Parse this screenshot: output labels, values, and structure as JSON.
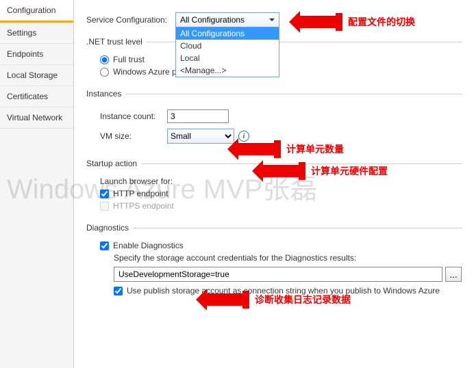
{
  "sidebar": {
    "items": [
      {
        "label": "Configuration"
      },
      {
        "label": "Settings"
      },
      {
        "label": "Endpoints"
      },
      {
        "label": "Local Storage"
      },
      {
        "label": "Certificates"
      },
      {
        "label": "Virtual Network"
      }
    ]
  },
  "serviceConfig": {
    "label": "Service Configuration:",
    "selected": "All Configurations",
    "options": [
      "All Configurations",
      "Cloud",
      "Local",
      "<Manage...>"
    ]
  },
  "trust": {
    "legend": ".NET trust level",
    "full": "Full trust",
    "partial": "Windows Azure partial trust"
  },
  "instances": {
    "legend": "Instances",
    "countLabel": "Instance count:",
    "countValue": "3",
    "vmLabel": "VM size:",
    "vmValue": "Small"
  },
  "startup": {
    "legend": "Startup action",
    "launchLabel": "Launch browser for:",
    "http": "HTTP endpoint",
    "https": "HTTPS endpoint"
  },
  "diagnostics": {
    "legend": "Diagnostics",
    "enable": "Enable Diagnostics",
    "specify": "Specify the storage account credentials for the Diagnostics results:",
    "storageValue": "UseDevelopmentStorage=true",
    "ellipsis": "...",
    "usePublish": "Use publish storage account as connection string when you publish to Windows Azure"
  },
  "annotations": {
    "a1": "配置文件的切换",
    "a2": "计算单元数量",
    "a3": "计算单元硬件配置",
    "a4": "诊断收集日志记录数据"
  },
  "watermark": "Windows Azure MVP张磊",
  "info_glyph": "i"
}
